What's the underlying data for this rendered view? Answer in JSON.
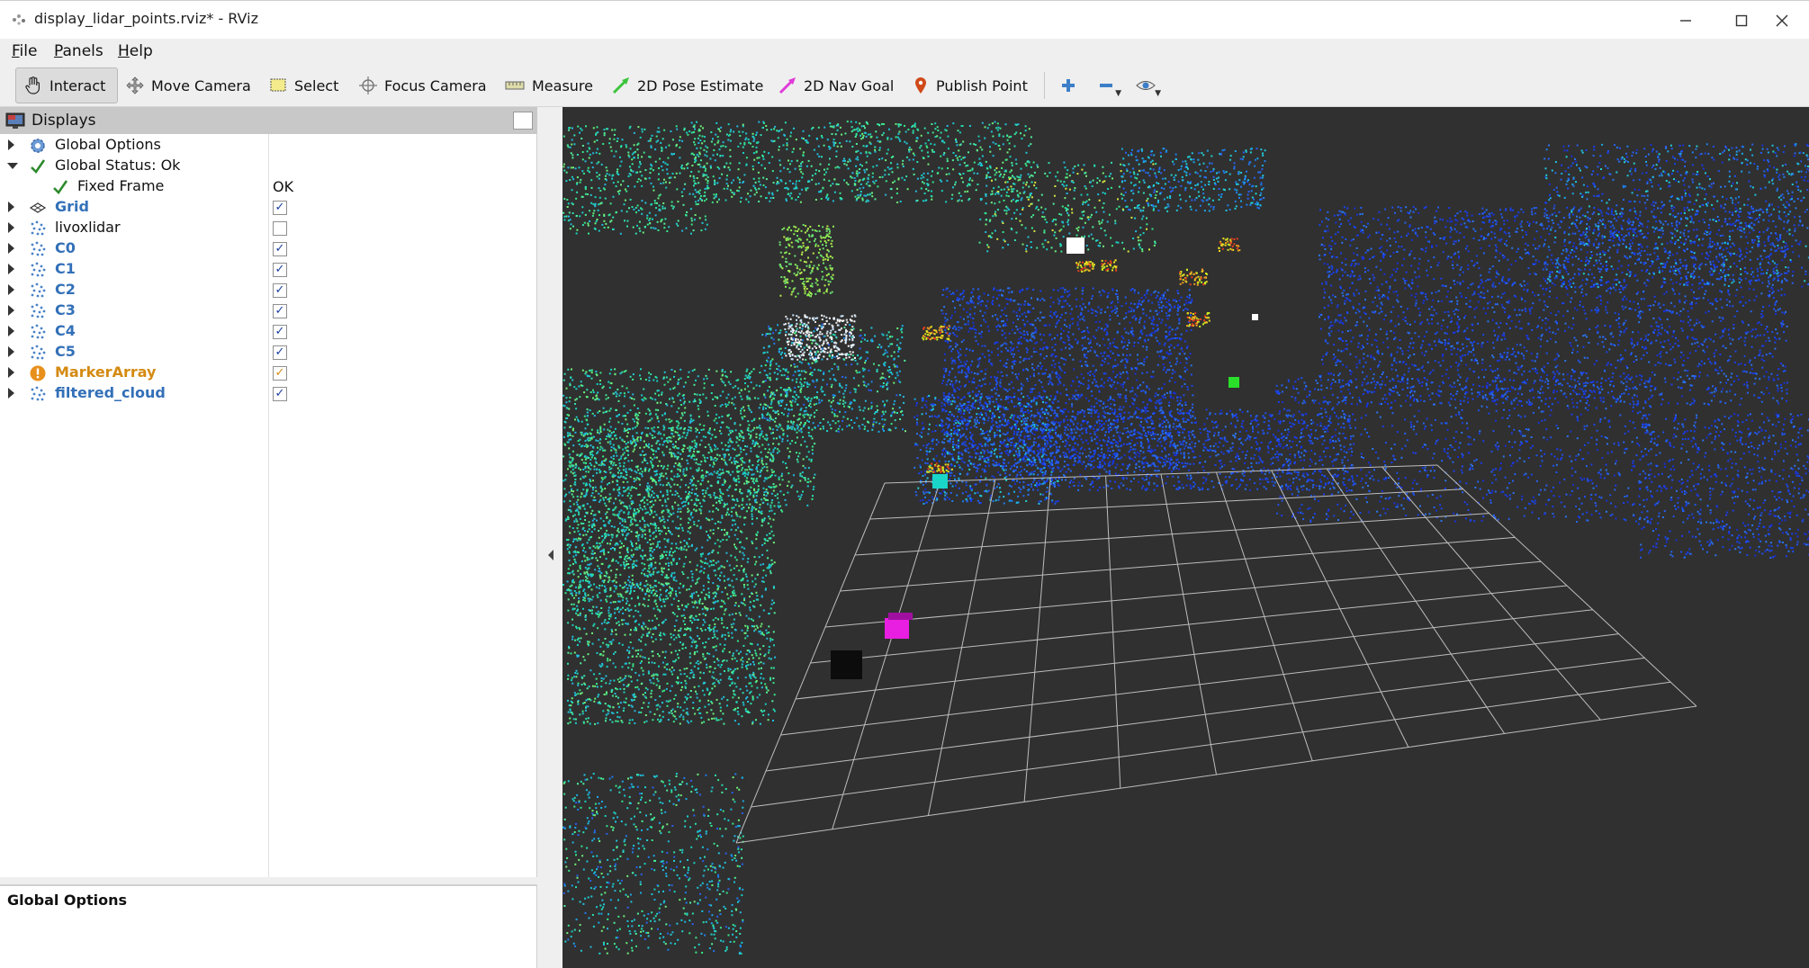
{
  "window": {
    "title": "display_lidar_points.rviz* - RViz"
  },
  "menubar": {
    "items": [
      "File",
      "Panels",
      "Help"
    ]
  },
  "toolbar": {
    "tools": [
      {
        "label": "Interact",
        "icon": "hand-icon",
        "active": true
      },
      {
        "label": "Move Camera",
        "icon": "move-camera-icon"
      },
      {
        "label": "Select",
        "icon": "select-icon"
      },
      {
        "label": "Focus Camera",
        "icon": "focus-camera-icon"
      },
      {
        "label": "Measure",
        "icon": "measure-icon"
      },
      {
        "label": "2D Pose Estimate",
        "icon": "pose-estimate-icon",
        "color": "#3cc43c"
      },
      {
        "label": "2D Nav Goal",
        "icon": "nav-goal-icon",
        "color": "#e03ad8"
      },
      {
        "label": "Publish Point",
        "icon": "map-pin-icon",
        "color": "#d04a1a"
      }
    ]
  },
  "displays": {
    "title": "Displays",
    "rows": [
      {
        "label": "Global Options",
        "style": "normal",
        "icon": "gear-icon",
        "expand": "closed",
        "value": ""
      },
      {
        "label": "Global Status: Ok",
        "style": "normal",
        "icon": "check-icon",
        "expand": "open",
        "value": ""
      },
      {
        "label": "Fixed Frame",
        "style": "normal",
        "icon": "check-icon",
        "expand": "none",
        "value": "OK"
      },
      {
        "label": "Grid",
        "style": "bold",
        "icon": "grid-icon",
        "expand": "closed",
        "checked": true
      },
      {
        "label": "livoxlidar",
        "style": "normal",
        "icon": "pointcloud-icon",
        "expand": "closed",
        "checked": false
      },
      {
        "label": "C0",
        "style": "bold",
        "icon": "pointcloud-icon",
        "expand": "closed",
        "checked": true
      },
      {
        "label": "C1",
        "style": "bold",
        "icon": "pointcloud-icon",
        "expand": "closed",
        "checked": true
      },
      {
        "label": "C2",
        "style": "bold",
        "icon": "pointcloud-icon",
        "expand": "closed",
        "checked": true
      },
      {
        "label": "C3",
        "style": "bold",
        "icon": "pointcloud-icon",
        "expand": "closed",
        "checked": true
      },
      {
        "label": "C4",
        "style": "bold",
        "icon": "pointcloud-icon",
        "expand": "closed",
        "checked": true
      },
      {
        "label": "C5",
        "style": "bold",
        "icon": "pointcloud-icon",
        "expand": "closed",
        "checked": true
      },
      {
        "label": "MarkerArray",
        "style": "warn",
        "icon": "warning-icon",
        "expand": "closed",
        "checked": true
      },
      {
        "label": "filtered_cloud",
        "style": "bold",
        "icon": "pointcloud-icon",
        "expand": "closed",
        "checked": true
      }
    ]
  },
  "description": {
    "title": "Global Options"
  },
  "colors": {
    "viewport_bg": "#303030",
    "accent_blue": "#3370b8",
    "warning": "#d48a12"
  }
}
